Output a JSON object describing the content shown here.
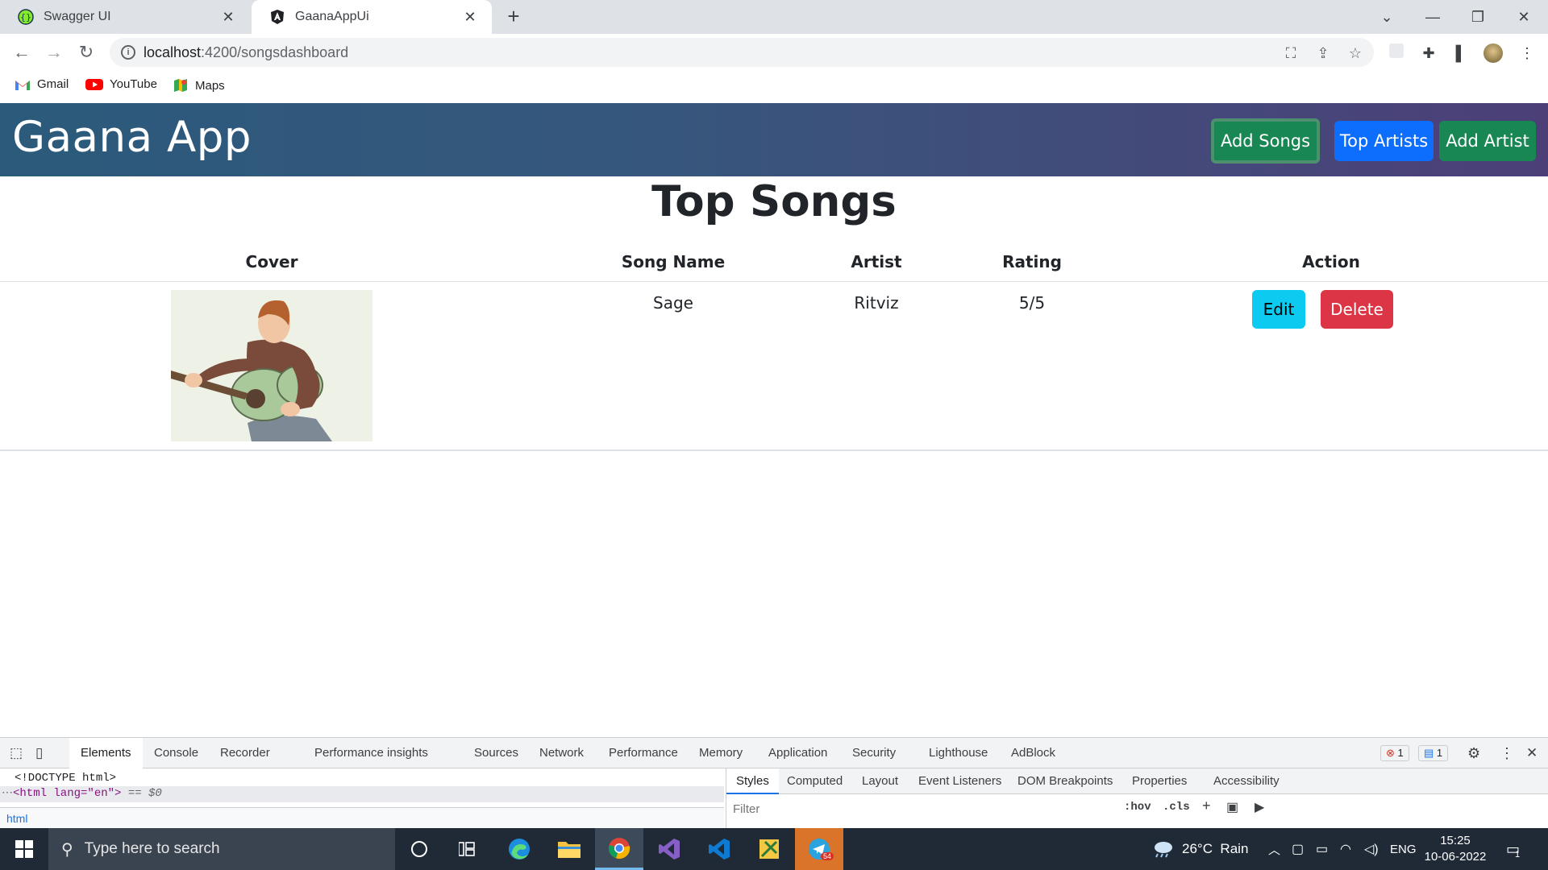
{
  "browser": {
    "tabs": [
      {
        "title": "Swagger UI",
        "icon": "swagger-icon"
      },
      {
        "title": "GaanaAppUi",
        "icon": "angular-icon"
      }
    ],
    "url_host": "localhost",
    "url_rest": ":4200/songsdashboard",
    "bookmarks": [
      {
        "label": "Gmail",
        "icon": "gmail-icon"
      },
      {
        "label": "YouTube",
        "icon": "youtube-icon"
      },
      {
        "label": "Maps",
        "icon": "maps-icon"
      }
    ]
  },
  "app": {
    "brand": "Gaana App",
    "nav": {
      "add_songs": "Add Songs",
      "top_artists": "Top Artists",
      "add_artist": "Add Artist"
    },
    "page_title": "Top Songs",
    "table": {
      "headers": {
        "cover": "Cover",
        "song_name": "Song Name",
        "artist": "Artist",
        "rating": "Rating",
        "action": "Action"
      },
      "rows": [
        {
          "cover": "guitar-player-illustration",
          "song_name": "Sage",
          "artist": "Ritviz",
          "rating": "5/5",
          "edit": "Edit",
          "delete": "Delete"
        }
      ]
    },
    "colors": {
      "add_songs": "#198754",
      "top_artists": "#0d6efd",
      "edit": "#0dcaf0",
      "delete": "#dc3545"
    }
  },
  "devtools": {
    "tabs": [
      "Elements",
      "Console",
      "Recorder",
      "Performance insights",
      "Sources",
      "Network",
      "Performance",
      "Memory",
      "Application",
      "Security",
      "Lighthouse",
      "AdBlock"
    ],
    "errors": "1",
    "messages": "1",
    "dom_line1": "<!DOCTYPE html>",
    "dom_line2_tag": "<html lang=\"en\">",
    "dom_line2_tail": " == $0",
    "breadcrumb": "html",
    "style_tabs": [
      "Styles",
      "Computed",
      "Layout",
      "Event Listeners",
      "DOM Breakpoints",
      "Properties",
      "Accessibility"
    ],
    "filter_placeholder": "Filter",
    "hov": ":hov",
    "cls": ".cls"
  },
  "taskbar": {
    "search_placeholder": "Type here to search",
    "weather": "26°C  Rain",
    "language": "ENG",
    "time": "15:25",
    "date": "10-06-2022",
    "notifications": "1",
    "telegram_badge": "54"
  }
}
